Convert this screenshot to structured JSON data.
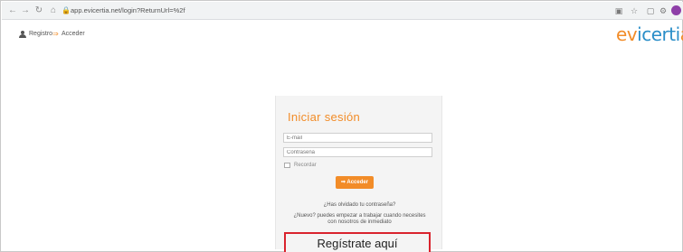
{
  "browser": {
    "url": "app.evicertia.net/login?ReturnUrl=%2f",
    "lock_icon": "lock-icon",
    "nav_icons": [
      "back-icon",
      "forward-icon",
      "reload-icon",
      "home-icon"
    ],
    "extension_icons": [
      "translate-icon",
      "star-icon",
      "extension-icon",
      "settings-icon"
    ],
    "profile_color": "#8e3fa8"
  },
  "header": {
    "register_label": "Registro",
    "login_label": "Acceder",
    "brand": {
      "a": "ev",
      "b": "icerti",
      "c": "a"
    }
  },
  "login": {
    "title": "Iniciar sesión",
    "email_placeholder": "E-mail",
    "password_placeholder": "Contraseña",
    "remember_label": "Recordar",
    "submit_label": "Acceder",
    "forgot_link": "¿Has olvidado tu contraseña?",
    "info_line_1": "¿Nuevo? puedes empezar a trabajar cuando necesites",
    "info_line_2": "con nosotros de inmediato",
    "register_cta": "Regístrate aquí"
  },
  "colors": {
    "accent": "#f28c28",
    "brand_blue": "#2a8ec8",
    "highlight": "#d9232d"
  }
}
